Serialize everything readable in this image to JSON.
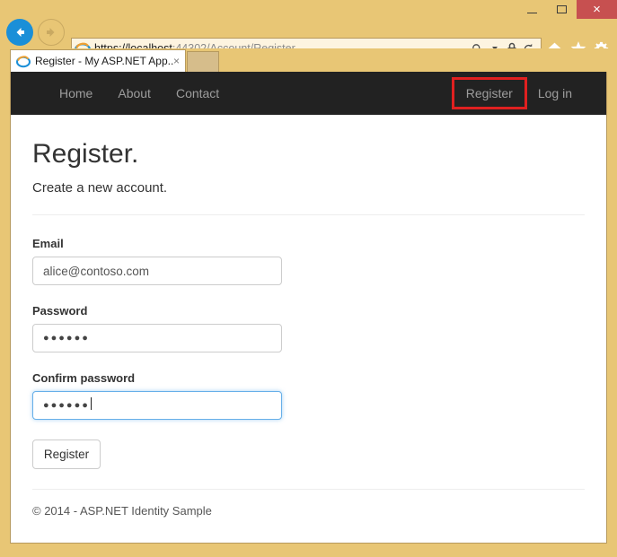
{
  "browser": {
    "window_controls": {
      "minimize": "minimize",
      "maximize": "maximize",
      "close": "×"
    },
    "back_label": "Back",
    "forward_label": "Forward",
    "address": {
      "scheme_host": "https://localhost",
      "port_path_dim": ":44302/",
      "highlighted_path": "Account/Register",
      "full_url": "https://localhost:44302/Account/Register",
      "search_icon": "search-icon",
      "lock_icon": "lock-icon",
      "refresh_icon": "refresh-icon"
    },
    "toolbar_icons": {
      "home": "home-icon",
      "favorites": "star-icon",
      "settings": "gear-icon"
    },
    "tab": {
      "title": "Register - My ASP.NET App...",
      "close": "×",
      "new_tab": "new-tab"
    }
  },
  "site_nav": {
    "left_links": [
      {
        "label": "Home",
        "name": "nav-link-home"
      },
      {
        "label": "About",
        "name": "nav-link-about"
      },
      {
        "label": "Contact",
        "name": "nav-link-contact"
      }
    ],
    "right_links": [
      {
        "label": "Register",
        "name": "nav-link-register",
        "highlighted": true
      },
      {
        "label": "Log in",
        "name": "nav-link-login",
        "highlighted": false
      }
    ],
    "highlight_color": "#e02020",
    "background_color": "#222222",
    "link_color": "#9d9d9d"
  },
  "page": {
    "title": "Register.",
    "subtitle": "Create a new account.",
    "fields": {
      "email": {
        "label": "Email",
        "value": "alice@contoso.com",
        "placeholder": ""
      },
      "password": {
        "label": "Password",
        "value": "●●●●●●",
        "placeholder": ""
      },
      "confirm_password": {
        "label": "Confirm password",
        "value": "●●●●●●",
        "placeholder": "",
        "focused": true
      }
    },
    "submit_label": "Register",
    "footer": "© 2014 - ASP.NET Identity Sample"
  }
}
